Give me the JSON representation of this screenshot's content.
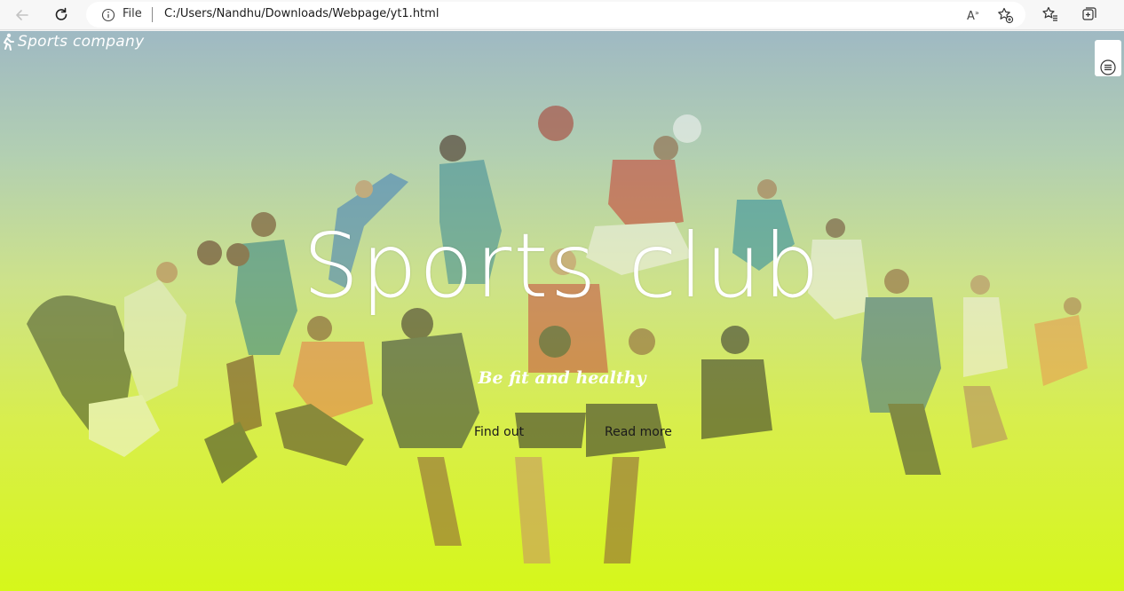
{
  "browser": {
    "address_prefix": "File",
    "url": "C:/Users/Nandhu/Downloads/Webpage/yt1.html"
  },
  "page": {
    "brand": "Sports company",
    "hero_title": "Sports club",
    "hero_subtitle": "Be fit and healthy",
    "buttons": {
      "find_out": "Find out",
      "read_more": "Read more"
    }
  },
  "colors": {
    "overlay_top": "#9fb9c3",
    "overlay_bottom": "#d6f71a",
    "text_light": "#ffffff"
  },
  "icons": {
    "back": "back-arrow-icon",
    "reload": "reload-icon",
    "info": "info-icon",
    "read_aloud": "read-aloud-icon",
    "add_favorite": "add-favorite-icon",
    "favorites": "favorites-icon",
    "collections": "collections-icon",
    "brand": "runner-icon",
    "menu": "menu-icon"
  }
}
